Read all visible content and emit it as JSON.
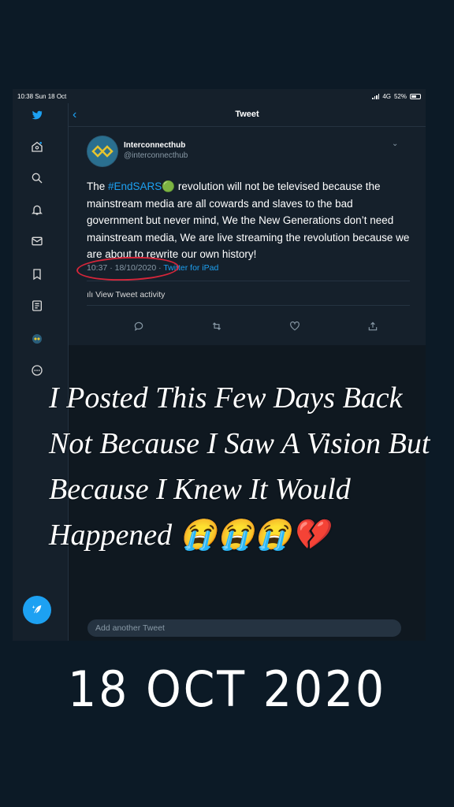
{
  "status_bar": {
    "time_date": "10:38  Sun 18 Oct",
    "network": "4G",
    "battery": "52%"
  },
  "sidebar": {
    "icons": [
      "twitter-bird",
      "home",
      "search",
      "notifications-bell",
      "messages-envelope",
      "bookmarks",
      "lists",
      "profile-avatar",
      "more-circle"
    ]
  },
  "header": {
    "title": "Tweet",
    "back": "‹"
  },
  "tweet": {
    "display_name": "Interconnecthub",
    "handle": "@interconnecthub",
    "text_before": "The ",
    "hashtag": "#EndSARS",
    "hashtag_emoji": "🟢",
    "text_after": " revolution will not be televised because the mainstream media are all cowards and slaves to the bad government but never mind, We the New Generations don’t need mainstream media, We are live streaming the revolution because we are about to rewrite our own history!",
    "timestamp": "10:37 · 18/10/2020 · ",
    "source": "Twitter for iPad",
    "activity_label": "View Tweet activity"
  },
  "reply": {
    "placeholder": "Add another Tweet"
  },
  "story_caption": "I Posted This Few Days Back Not Because I Saw A Vision But Because I Knew It Would Happened 😭😭😭💔",
  "date_stamp": "18 OCT 2020",
  "colors": {
    "accent": "#1da1f2",
    "background": "#15202b",
    "circle": "#d6263a"
  }
}
